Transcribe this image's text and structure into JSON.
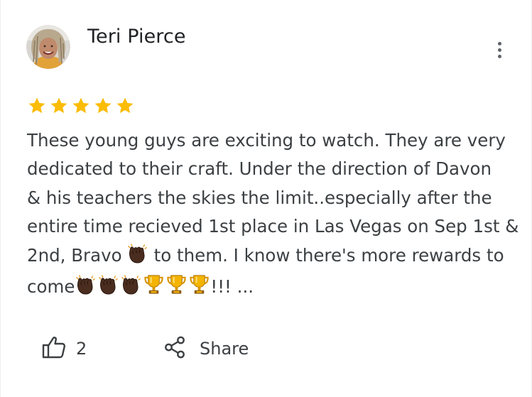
{
  "review": {
    "reviewer_name": "Teri Pierce",
    "rating": 5,
    "star_color": "#fbbc04",
    "text_lines": [
      "These young guys are exciting to watch. They are very",
      "dedicated to their craft. Under the direction of Davon",
      "& his teachers the skies the limit..especially after the",
      "entire time recieved 1st place in Las Vegas on Sep 1st &"
    ],
    "line5_before": "2nd, Bravo",
    "line5_after": "to them. I know there's more rewards to",
    "line6_before": "come",
    "line6_after": "!!! ...",
    "emoji_sequence": [
      "clapping-hands",
      "clapping-hands",
      "clapping-hands",
      "trophy",
      "trophy",
      "trophy"
    ]
  },
  "actions": {
    "like_icon": "thumb-up-outline-icon",
    "like_count": "2",
    "share_icon": "share-icon",
    "share_label": "Share",
    "more_icon": "more-vert-icon"
  }
}
